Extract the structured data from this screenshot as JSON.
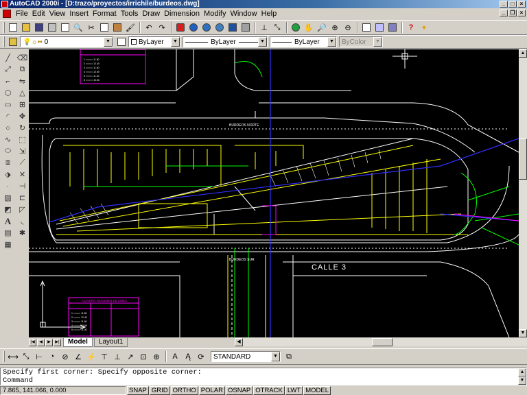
{
  "window": {
    "title": "AutoCAD 2000i - [D:trazo/proyectos/irrichile/burdeos.dwg]"
  },
  "menu": [
    "File",
    "Edit",
    "View",
    "Insert",
    "Format",
    "Tools",
    "Draw",
    "Dimension",
    "Modify",
    "Window",
    "Help"
  ],
  "properties_bar": {
    "layer_value": "0",
    "color_value": "ByLayer",
    "linetype_value": "ByLayer",
    "lineweight_value": "ByLayer",
    "plotstyle_value": "ByColor"
  },
  "drawing": {
    "street_labels": [
      "BURDEOS NORTE",
      "BURDEOS SUR",
      "CALLE 3"
    ],
    "table_title": "CUADRO RESUMEN DE LINEA",
    "colors": {
      "background": "#000000",
      "curb": "#ffffff",
      "pipe": "#ffff00",
      "sprinkler": "#00ff00",
      "axis": "#0000ff",
      "table": "#ff00ff"
    }
  },
  "tabs": [
    "Model",
    "Layout1"
  ],
  "dimstyle_value": "STANDARD",
  "command": {
    "history": "Specify first corner: Specify opposite corner:",
    "prompt": "Command"
  },
  "status": {
    "coords": "7.865, 141.066, 0.000",
    "toggles": [
      "SNAP",
      "GRID",
      "ORTHO",
      "POLAR",
      "OSNAP",
      "OTRACK",
      "LWT",
      "MODEL"
    ]
  }
}
